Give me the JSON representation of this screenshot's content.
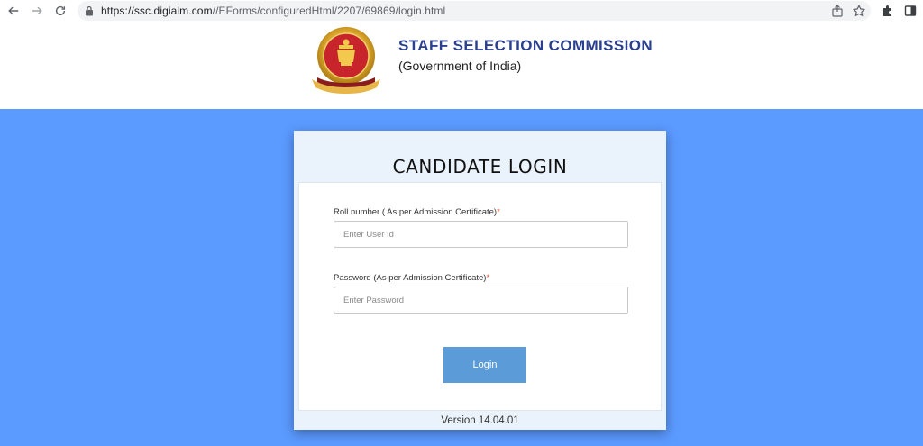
{
  "browser": {
    "url_host": "https://ssc.digialm.com",
    "url_path": "//EForms/configuredHtml/2207/69869/login.html"
  },
  "header": {
    "org_name": "STAFF SELECTION COMMISSION",
    "org_sub": "(Government of India)"
  },
  "login": {
    "title": "CANDIDATE LOGIN",
    "roll_label": "Roll number ( As per Admission Certificate)",
    "roll_required": "*",
    "roll_placeholder": "Enter User Id",
    "password_label": "Password (As per Admission Certificate)",
    "password_required": "*",
    "password_placeholder": "Enter Password",
    "button_label": "Login",
    "version": "Version 14.04.01"
  },
  "colors": {
    "page_blue": "#5b9aff",
    "button_blue": "#5a9bd8",
    "title_navy": "#2b3f8f",
    "required_mark": "#e2502b"
  }
}
